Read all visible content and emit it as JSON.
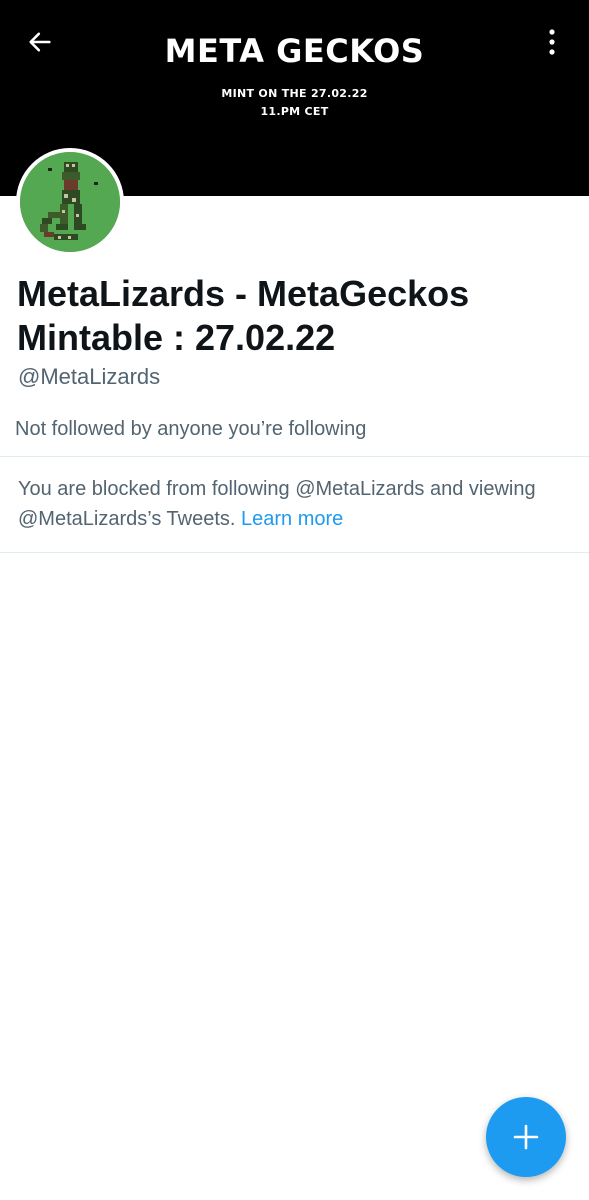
{
  "banner": {
    "title": "META GECKOS",
    "subtitle_line1": "MINT ON THE 27.02.22",
    "subtitle_line2": "11.PM CET",
    "background_color": "#000000"
  },
  "header": {
    "back_icon": "arrow-left-icon",
    "more_icon": "more-vertical-icon"
  },
  "profile": {
    "avatar_icon": "gecko-avatar",
    "name_line1": "MetaLizards - MetaGeckos",
    "name_line2": "Mintable : 27.02.22",
    "handle": "@MetaLizards",
    "followed_by": "Not followed by anyone you’re following"
  },
  "blocked_notice": {
    "text": "You are blocked from following @MetaLizards and viewing @MetaLizards’s Tweets.",
    "link_label": "Learn more",
    "link_color": "#1d9bf0"
  },
  "fab": {
    "icon": "plus-icon",
    "color": "#1d9bf0"
  }
}
